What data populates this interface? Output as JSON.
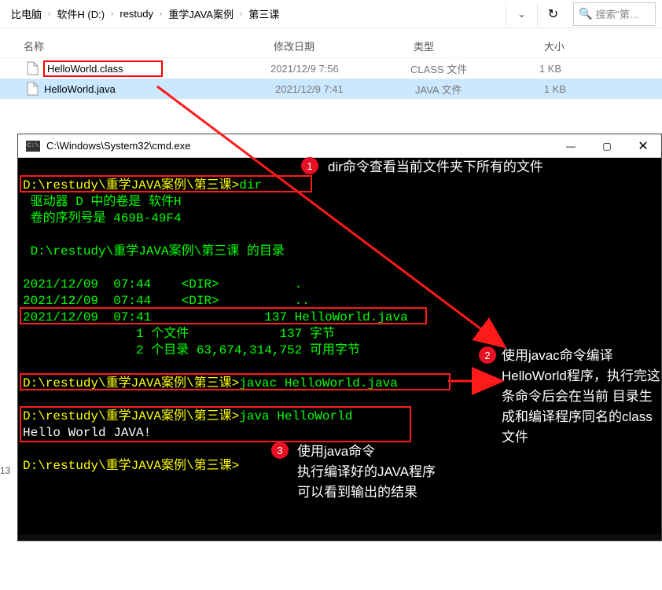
{
  "breadcrumbs": [
    "比电脑",
    "软件H (D:)",
    "restudy",
    "重学JAVA案例",
    "第三课"
  ],
  "search_placeholder": "搜索\"第...",
  "columns": {
    "name": "名称",
    "date": "修改日期",
    "type": "类型",
    "size": "大小"
  },
  "files": [
    {
      "name": "HelloWorld.class",
      "date": "2021/12/9 7:56",
      "type": "CLASS 文件",
      "size": "1 KB",
      "highlight": true
    },
    {
      "name": "HelloWorld.java",
      "date": "2021/12/9 7:41",
      "type": "JAVA 文件",
      "size": "1 KB",
      "highlight": false
    }
  ],
  "cmd_title": "C:\\Windows\\System32\\cmd.exe",
  "terminal": {
    "p1_prompt": "D:\\restudy\\重学JAVA案例\\第三课>",
    "p1_cmd": "dir",
    "vol1": " 驱动器 D 中的卷是 软件H",
    "vol2": " 卷的序列号是 469B-49F4",
    "dirof": " D:\\restudy\\重学JAVA案例\\第三课 的目录",
    "d1": "2021/12/09  07:44    <DIR>          .",
    "d2": "2021/12/09  07:44    <DIR>          ..",
    "d3": "2021/12/09  07:41               137 HelloWorld.java",
    "sum1": "               1 个文件            137 字节",
    "sum2": "               2 个目录 63,674,314,752 可用字节",
    "p2_prompt": "D:\\restudy\\重学JAVA案例\\第三课>",
    "p2_cmd": "javac HelloWorld.java",
    "p3_prompt": "D:\\restudy\\重学JAVA案例\\第三课>",
    "p3_cmd": "java HelloWorld",
    "out": "Hello World JAVA!",
    "p4_prompt": "D:\\restudy\\重学JAVA案例\\第三课>"
  },
  "badges": {
    "b1": "1",
    "b2": "2",
    "b3": "3"
  },
  "annotations": {
    "a1": "dir命令查看当前文件夹下所有的文件",
    "a2": "使用javac命令编译HelloWorld程序，执行完这条命令后会在当前 目录生成和编译程序同名的class文件",
    "a3": "使用java命令\n执行编译好的JAVA程序\n可以看到输出的结果"
  },
  "sidecount": "13"
}
